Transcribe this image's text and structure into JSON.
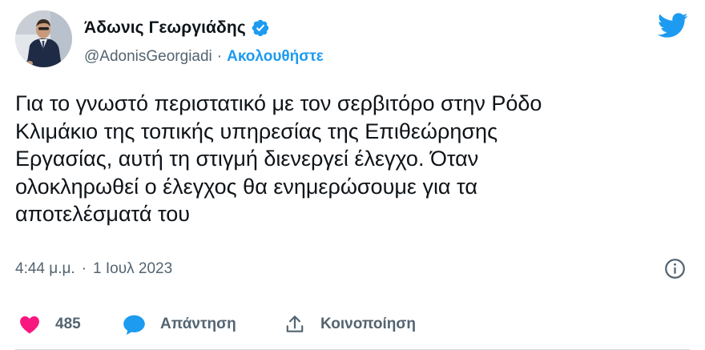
{
  "tweet": {
    "display_name": "Άδωνις Γεωργιάδης",
    "handle": "@AdonisGeorgiadi",
    "separator": "·",
    "follow_label": "Ακολουθήστε",
    "text": "Για το γνωστό περιστατικό με τον σερβιτόρο στην Ρόδο\nΚλιμάκιο της τοπικής υπηρεσίας της Επιθεώρησης\nΕργασίας, αυτή τη στιγμή διενεργεί έλεγχο. Όταν\nολοκληρωθεί ο έλεγχος θα ενημερώσουμε για τα\nαποτελέσματά του",
    "time": "4:44 μ.μ.",
    "date": "1 Ιουλ 2023",
    "likes": "485",
    "reply_label": "Απάντηση",
    "share_label": "Κοινοποίηση"
  },
  "icons": {
    "verified": "verified-badge-icon",
    "logo": "twitter-bird-icon",
    "info": "info-icon",
    "like": "heart-icon",
    "reply": "speech-bubble-icon",
    "share": "share-upload-icon"
  },
  "colors": {
    "accent": "#1d9bf0",
    "like": "#f91880",
    "text": "#0f1419",
    "muted": "#536471"
  }
}
